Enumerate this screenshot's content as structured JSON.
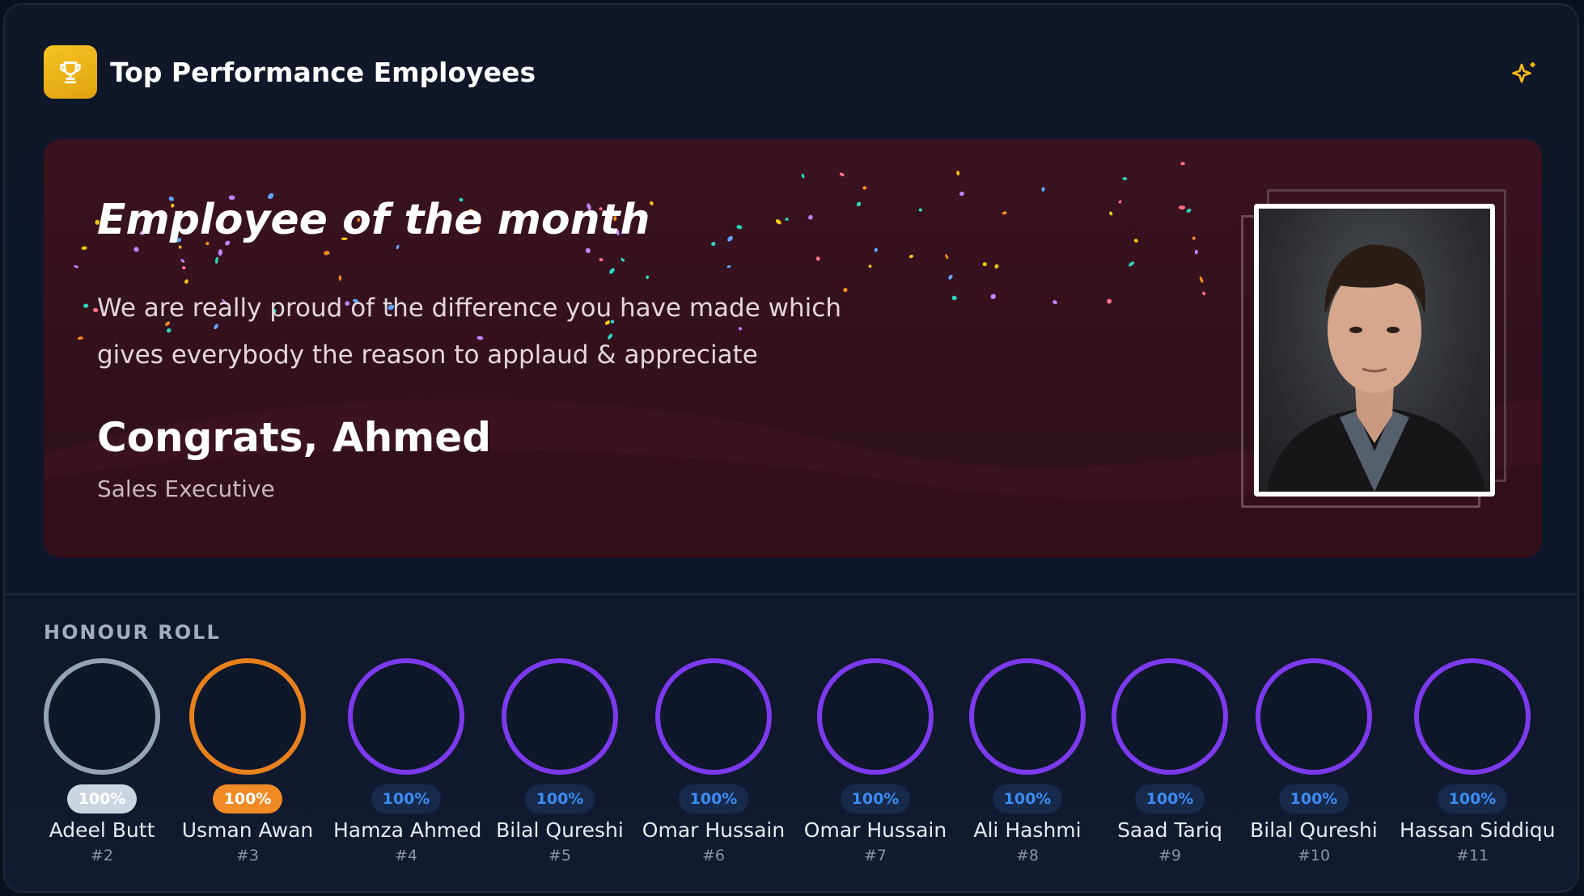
{
  "header": {
    "title": "Top Performance Employees",
    "badge_icon": "trophy-icon",
    "action_icon": "sparkles-icon"
  },
  "hero": {
    "heading": "Employee of the month",
    "message": "We are really proud of the difference you have made which gives everybody the reason to applaud & appreciate",
    "congrats": "Congrats, Ahmed",
    "role": "Sales Executive"
  },
  "honour_roll": {
    "label": "HONOUR ROLL",
    "items": [
      {
        "name": "Adeel Butt",
        "rank": "#2",
        "score": "100%",
        "ring": "#94a3b8",
        "badge_bg": "#cbd5e1",
        "badge_fg": "#ffffff"
      },
      {
        "name": "Usman Awan",
        "rank": "#3",
        "score": "100%",
        "ring": "#e8811d",
        "badge_bg": "#f08a24",
        "badge_fg": "#ffffff"
      },
      {
        "name": "Hamza Ahmed",
        "rank": "#4",
        "score": "100%",
        "ring": "#7c3aed",
        "badge_bg": "#172a4c",
        "badge_fg": "#3b8cf2"
      },
      {
        "name": "Bilal Qureshi",
        "rank": "#5",
        "score": "100%",
        "ring": "#7c3aed",
        "badge_bg": "#172a4c",
        "badge_fg": "#3b8cf2"
      },
      {
        "name": "Omar Hussain",
        "rank": "#6",
        "score": "100%",
        "ring": "#7c3aed",
        "badge_bg": "#172a4c",
        "badge_fg": "#3b8cf2"
      },
      {
        "name": "Omar Hussain",
        "rank": "#7",
        "score": "100%",
        "ring": "#7c3aed",
        "badge_bg": "#172a4c",
        "badge_fg": "#3b8cf2"
      },
      {
        "name": "Ali Hashmi",
        "rank": "#8",
        "score": "100%",
        "ring": "#7c3aed",
        "badge_bg": "#172a4c",
        "badge_fg": "#3b8cf2"
      },
      {
        "name": "Saad Tariq",
        "rank": "#9",
        "score": "100%",
        "ring": "#7c3aed",
        "badge_bg": "#172a4c",
        "badge_fg": "#3b8cf2"
      },
      {
        "name": "Bilal Qureshi",
        "rank": "#10",
        "score": "100%",
        "ring": "#7c3aed",
        "badge_bg": "#172a4c",
        "badge_fg": "#3b8cf2"
      },
      {
        "name": "Hassan Siddiqu",
        "rank": "#11",
        "score": "100%",
        "ring": "#7c3aed",
        "badge_bg": "#172a4c",
        "badge_fg": "#3b8cf2"
      }
    ]
  },
  "colors": {
    "background": "#0f172a",
    "hero": "#2c0f1a",
    "accent_gold": "#f5b915",
    "accent_purple": "#7c3aed"
  }
}
